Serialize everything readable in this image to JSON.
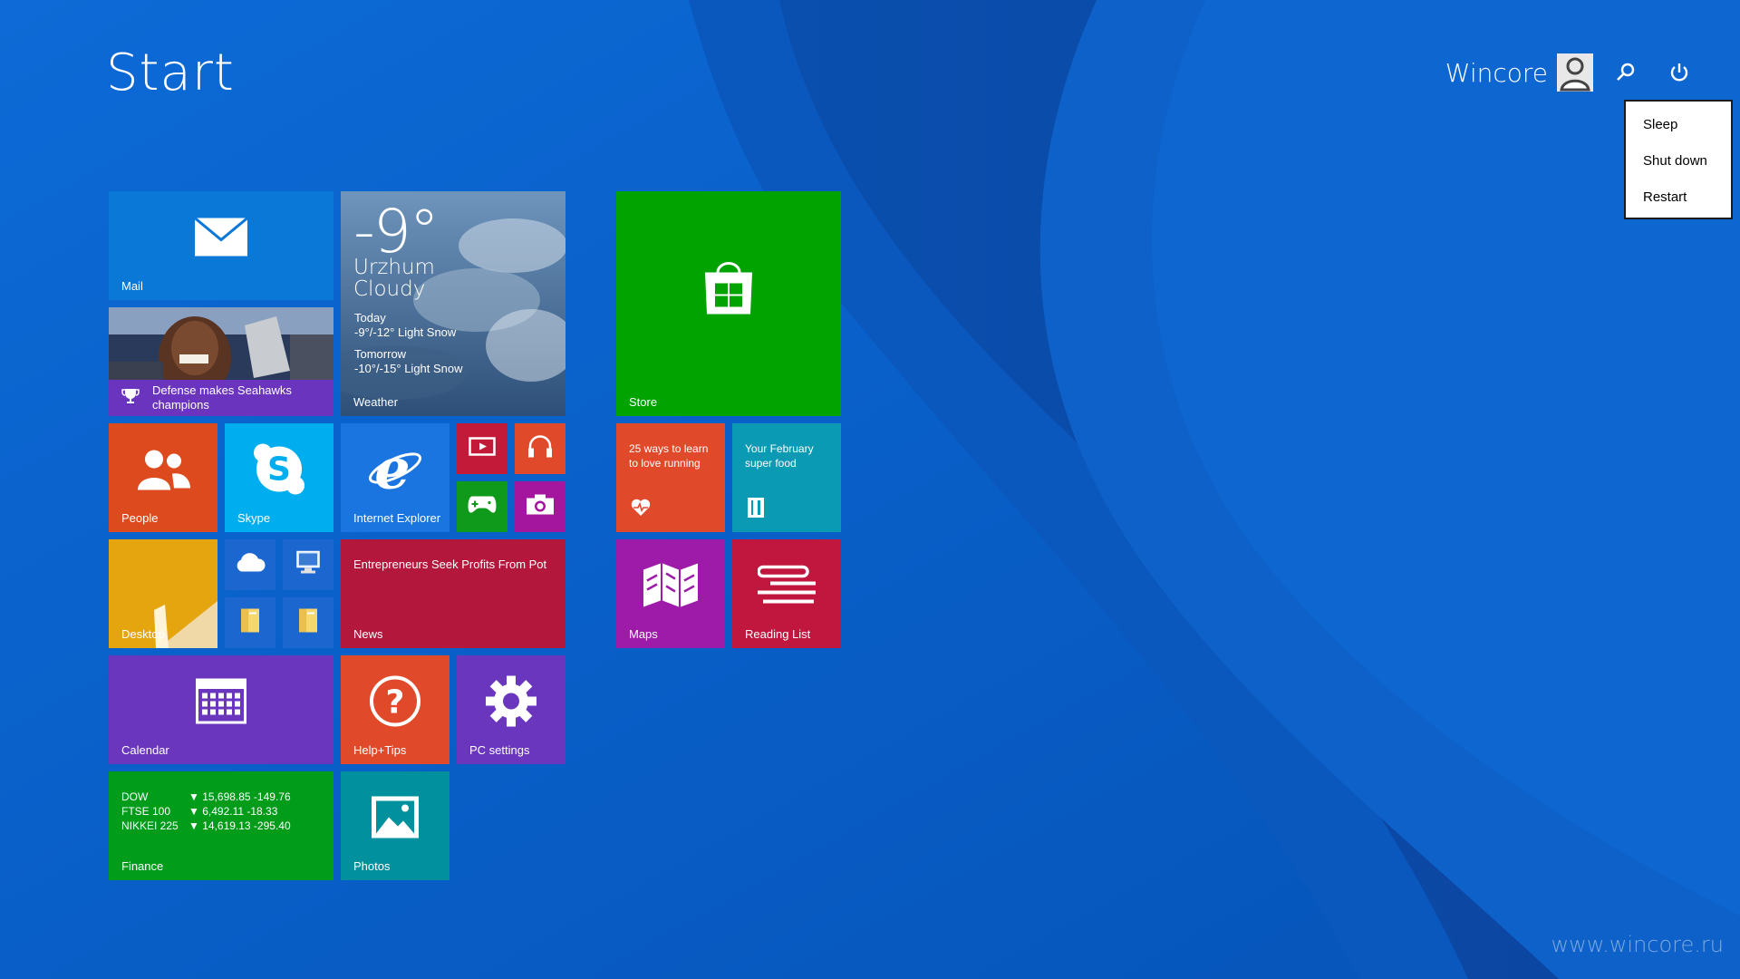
{
  "header": {
    "title": "Start",
    "user_name": "Wincore"
  },
  "power_menu": {
    "items": [
      "Sleep",
      "Shut down",
      "Restart"
    ]
  },
  "tiles": {
    "mail": {
      "label": "Mail"
    },
    "weather": {
      "temp": "-9°",
      "city": "Urzhum",
      "condition": "Cloudy",
      "today_label": "Today",
      "today_forecast": "-9°/-12° Light Snow",
      "tomorrow_label": "Tomorrow",
      "tomorrow_forecast": "-10°/-15° Light Snow",
      "label": "Weather"
    },
    "store": {
      "label": "Store"
    },
    "sports": {
      "headline_line1": "Defense makes Seahawks",
      "headline_line2": "champions"
    },
    "people": {
      "label": "People"
    },
    "skype": {
      "label": "Skype"
    },
    "ie": {
      "label": "Internet Explorer"
    },
    "health": {
      "line1": "25 ways to learn",
      "line2": "to love running"
    },
    "food": {
      "line1": "Your February",
      "line2": "super food"
    },
    "desktop": {
      "label": "Desktop"
    },
    "news": {
      "headline": "Entrepreneurs Seek Profits From Pot",
      "label": "News"
    },
    "maps": {
      "label": "Maps"
    },
    "reading": {
      "label": "Reading List"
    },
    "calendar": {
      "label": "Calendar"
    },
    "help": {
      "label": "Help+Tips"
    },
    "pcsettings": {
      "label": "PC settings"
    },
    "finance": {
      "label": "Finance",
      "rows": [
        {
          "name": "DOW",
          "value": "▼ 15,698.85 -149.76"
        },
        {
          "name": "FTSE 100",
          "value": "▼ 6,492.11 -18.33"
        },
        {
          "name": "NIKKEI 225",
          "value": "▼ 14,619.13 -295.40"
        }
      ]
    },
    "photos": {
      "label": "Photos"
    }
  },
  "colors": {
    "background": "#0b5fc8",
    "mail": "#0a78d7",
    "store": "#00a300",
    "people": "#dc4a1e",
    "skype": "#00aef0",
    "ie": "#1b75e0",
    "news": "#b3173c",
    "maps": "#9e1aa8",
    "reading": "#c1163e",
    "calendar": "#6a36bd",
    "help": "#e0492a",
    "pcsettings": "#6a36bd",
    "finance": "#009c1a",
    "photos": "#00909e"
  },
  "watermark": "www.wincore.ru"
}
